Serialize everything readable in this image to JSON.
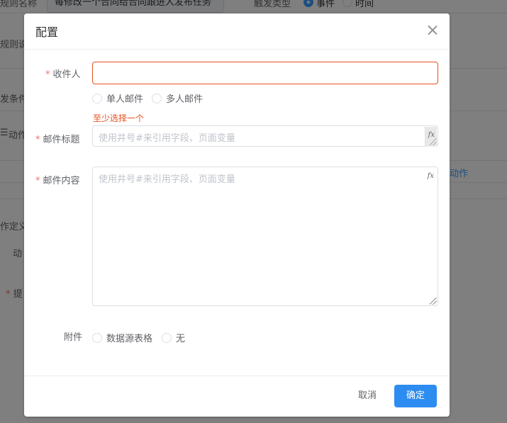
{
  "background": {
    "rule_name_label": "规则名称",
    "rule_name_value": "每修改一个合同给合同跟进人发布任务",
    "trigger_type_label": "触发类型",
    "trigger_type_options": [
      "事件",
      "时间"
    ],
    "rule_desc_label": "规则说",
    "trigger_condition_label": "发条件",
    "action_label": "动作",
    "action_tab": "动作",
    "action_define_label": "作定义",
    "action_label2": "动",
    "remind_label": "提"
  },
  "dialog": {
    "title": "配置",
    "recipient_label": "收件人",
    "recipient_value": "",
    "recipient_options": [
      "单人邮件",
      "多人邮件"
    ],
    "recipient_error": "至少选择一个",
    "subject_label": "邮件标题",
    "subject_placeholder": "使用井号#来引用字段、页面变量",
    "content_label": "邮件内容",
    "content_placeholder": "使用井号#来引用字段、页面变量",
    "fx_icon": "fx",
    "attachment_label": "附件",
    "attachment_options": [
      "数据源表格",
      "无"
    ],
    "cancel_label": "取消",
    "confirm_label": "确定"
  },
  "colors": {
    "primary": "#2d8cf0",
    "error": "#e6501e",
    "required_star": "#f56c6c"
  }
}
